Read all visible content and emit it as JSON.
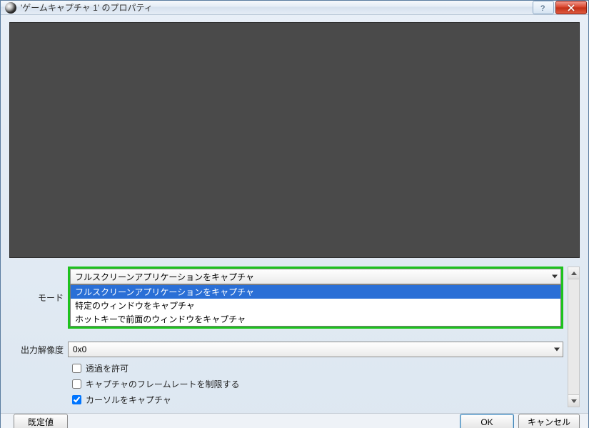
{
  "window": {
    "title": "'ゲームキャプチャ 1' のプロパティ"
  },
  "form": {
    "mode_label": "モード",
    "mode_value": "フルスクリーンアプリケーションをキャプチャ",
    "mode_options": [
      "フルスクリーンアプリケーションをキャプチャ",
      "特定のウィンドウをキャプチャ",
      "ホットキーで前面のウィンドウをキャプチャ"
    ],
    "resolution_label": "出力解像度",
    "resolution_value": "0x0",
    "allow_transparency_label": "透過を許可",
    "limit_framerate_label": "キャプチャのフレームレートを制限する",
    "capture_cursor_label": "カーソルをキャプチャ",
    "allow_transparency_checked": false,
    "limit_framerate_checked": false,
    "capture_cursor_checked": true
  },
  "footer": {
    "defaults": "既定値",
    "ok": "OK",
    "cancel": "キャンセル"
  }
}
